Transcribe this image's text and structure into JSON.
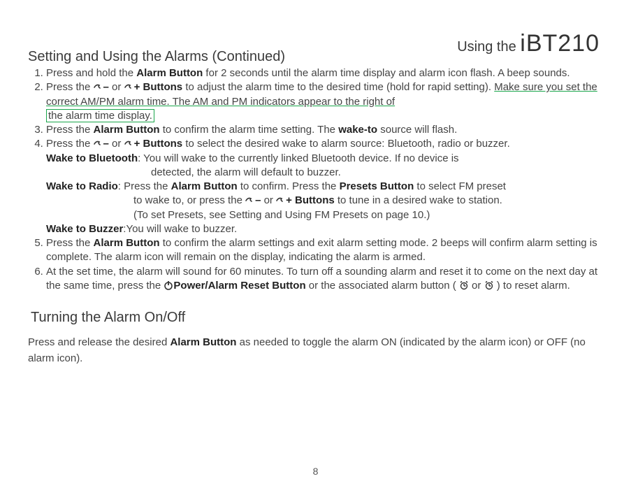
{
  "header": {
    "section_title": "Setting and Using the Alarms (Continued)",
    "product_prefix": "Using the ",
    "product_model": "iBT210"
  },
  "steps": {
    "s1a": "Press and hold the ",
    "s1b": "Alarm Button",
    "s1c": " for 2 seconds until the alarm time display and alarm icon flash. A beep sounds.",
    "s2a": "Press the ",
    "s2b": " or ",
    "s2c": " Buttons",
    "s2d": " to adjust the alarm time to the desired time (hold for rapid setting). ",
    "s2e1": "Make sure you set the correct AM/PM alarm time. The AM and PM indicators appear to the right of",
    "s2e2": "the alarm time display.",
    "s3a": "Press the ",
    "s3b": "Alarm Button",
    "s3c": " to confirm the alarm time setting. The ",
    "s3d": "wake-to",
    "s3e": " source will flash.",
    "s4a": "Press the ",
    "s4b": " or ",
    "s4c": " Buttons",
    "s4d": " to select the desired wake to alarm source: Bluetooth, radio or buzzer.",
    "wbt_label": "Wake to Bluetooth",
    "wbt_text": ": You will wake to the currently linked Bluetooth device. If no device is",
    "wbt_text2": "detected, the alarm will default to buzzer.",
    "wr_label": "Wake to Radio",
    "wr_text_a": ": Press the ",
    "wr_text_b": "Alarm Button",
    "wr_text_c": " to confirm. Press the ",
    "wr_text_d": "Presets Button",
    "wr_text_e": " to select FM preset",
    "wr_line2a": "to wake to, or press the ",
    "wr_line2b": " or ",
    "wr_line2c": " Buttons",
    "wr_line2d": " to tune in a desired wake to station.",
    "wr_line3": "(To set Presets, see Setting and Using FM Presets on page 10.)",
    "wbz_label": "Wake to Buzzer",
    "wbz_text": ":You will wake to buzzer.",
    "s5a": "Press the ",
    "s5b": "Alarm Button",
    "s5c": " to confirm the alarm settings and exit alarm setting mode. 2 beeps will confirm alarm setting is complete. The alarm icon will remain on the display, indicating the alarm is armed.",
    "s6a": "At the set time, the alarm will sound for 60 minutes. To turn off a sounding alarm and reset it to come on the next day at the same time, press the ",
    "s6b": "Power/Alarm Reset Button",
    "s6c": " or the associated alarm button ( ",
    "s6d": " or ",
    "s6e": " ) to reset alarm."
  },
  "section2_title": "Turning the Alarm On/Off",
  "para2a": "Press and release the desired ",
  "para2b": "Alarm Button",
  "para2c": " as needed to toggle the alarm ON (indicated by the alarm icon) or OFF (no alarm icon).",
  "page_number": "8",
  "icons": {
    "tune_minus": "tune-minus-icon",
    "tune_plus": "tune-plus-icon",
    "power": "power-icon",
    "alarm1": "alarm1-icon",
    "alarm2": "alarm2-icon"
  }
}
